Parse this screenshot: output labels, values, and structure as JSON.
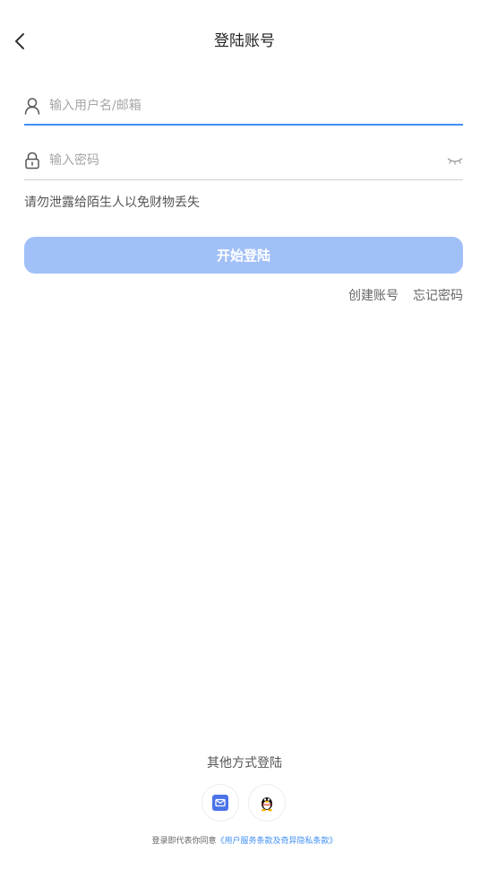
{
  "header": {
    "title": "登陆账号"
  },
  "form": {
    "username_placeholder": "输入用户名/邮箱",
    "username_value": "",
    "password_placeholder": "输入密码",
    "password_value": ""
  },
  "warning_text": "请勿泄露给陌生人以免财物丢失",
  "login_button_label": "开始登陆",
  "links": {
    "create_account": "创建账号",
    "forgot_password": "忘记密码"
  },
  "other_login": {
    "title": "其他方式登陆",
    "methods": [
      {
        "name": "email",
        "icon": "mail-icon"
      },
      {
        "name": "qq",
        "icon": "qq-penguin-icon"
      }
    ]
  },
  "agreement": {
    "prefix": "登录即代表你同意",
    "link_text": "《用户服务条款及奇异隐私条款》"
  },
  "colors": {
    "accent": "#3f8ff5",
    "button_disabled": "#a2c0f8",
    "mail_icon": "#4a73e8"
  }
}
